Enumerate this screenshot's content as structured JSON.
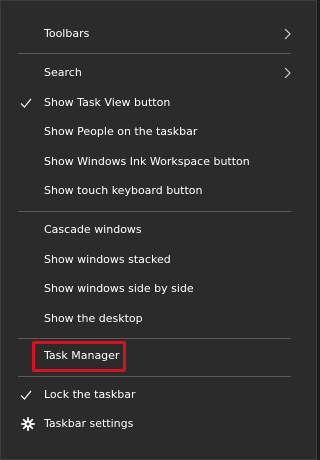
{
  "menu": {
    "items": [
      {
        "label": "Toolbars",
        "submenu_icon": "chevron-right-icon"
      },
      {
        "label": "Search",
        "submenu_icon": "chevron-right-icon"
      },
      {
        "label": "Show Task View button",
        "checked": true,
        "check_icon": "checkmark-icon"
      },
      {
        "label": "Show People on the taskbar"
      },
      {
        "label": "Show Windows Ink Workspace button"
      },
      {
        "label": "Show touch keyboard button"
      },
      {
        "label": "Cascade windows"
      },
      {
        "label": "Show windows stacked"
      },
      {
        "label": "Show windows side by side"
      },
      {
        "label": "Show the desktop"
      },
      {
        "label": "Task Manager",
        "highlighted": true
      },
      {
        "label": "Lock the taskbar",
        "checked": true,
        "check_icon": "checkmark-icon"
      },
      {
        "label": "Taskbar settings",
        "icon": "gear-icon"
      }
    ]
  },
  "colors": {
    "menu_background": "#2b2b2b",
    "text": "#ffffff",
    "separator": "#5a5a5a",
    "highlight_border": "#d9111e"
  }
}
